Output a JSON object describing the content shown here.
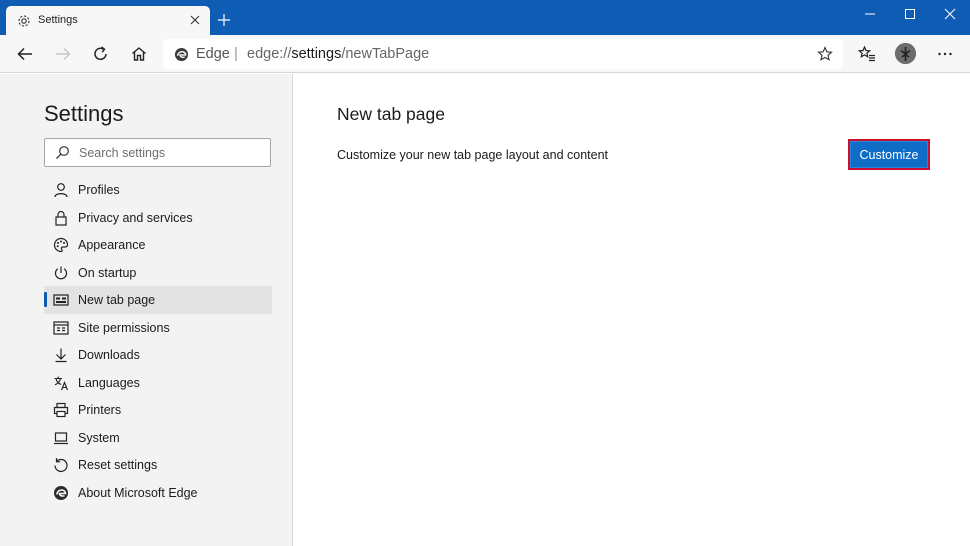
{
  "tab": {
    "title": "Settings"
  },
  "address_bar": {
    "site_label": "Edge",
    "url_prefix": "edge://",
    "url_path": "settings",
    "url_suffix": "/newTabPage"
  },
  "sidebar": {
    "title": "Settings",
    "search_placeholder": "Search settings",
    "items": [
      {
        "label": "Profiles",
        "icon": "person-icon",
        "active": false
      },
      {
        "label": "Privacy and services",
        "icon": "lock-icon",
        "active": false
      },
      {
        "label": "Appearance",
        "icon": "palette-icon",
        "active": false
      },
      {
        "label": "On startup",
        "icon": "power-icon",
        "active": false
      },
      {
        "label": "New tab page",
        "icon": "new-tab-page-icon",
        "active": true
      },
      {
        "label": "Site permissions",
        "icon": "site-permissions-icon",
        "active": false
      },
      {
        "label": "Downloads",
        "icon": "download-icon",
        "active": false
      },
      {
        "label": "Languages",
        "icon": "languages-icon",
        "active": false
      },
      {
        "label": "Printers",
        "icon": "printer-icon",
        "active": false
      },
      {
        "label": "System",
        "icon": "laptop-icon",
        "active": false
      },
      {
        "label": "Reset settings",
        "icon": "reset-icon",
        "active": false
      },
      {
        "label": "About Microsoft Edge",
        "icon": "edge-logo-icon",
        "active": false
      }
    ]
  },
  "main": {
    "title": "New tab page",
    "description": "Customize your new tab page layout and content",
    "customize_label": "Customize"
  },
  "colors": {
    "titlebar": "#0f5cb5",
    "accent": "#0f6cc7",
    "highlight_border": "#c8102e"
  }
}
